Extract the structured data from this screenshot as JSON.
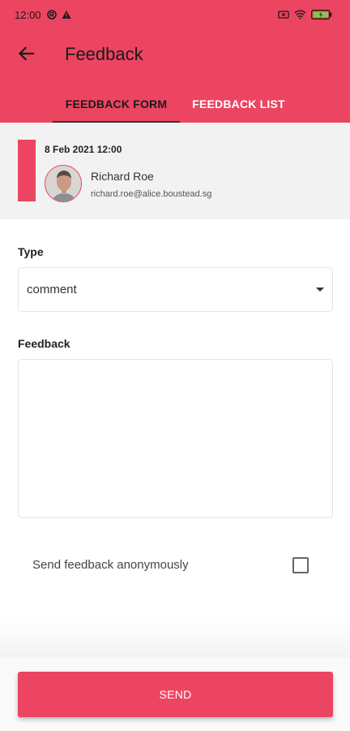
{
  "status_bar": {
    "time": "12:00",
    "left_icons": [
      "app-notification-icon",
      "alert-icon"
    ],
    "right_icons": [
      "screen-cast-icon",
      "wifi-icon",
      "battery-icon"
    ]
  },
  "header": {
    "title": "Feedback",
    "back_icon": "arrow-left-icon"
  },
  "tabs": [
    {
      "label": "FEEDBACK FORM",
      "active": true
    },
    {
      "label": "FEEDBACK LIST",
      "active": false
    }
  ],
  "info_card": {
    "date": "8 Feb 2021 12:00",
    "user_name": "Richard Roe",
    "user_email": "richard.roe@alice.boustead.sg"
  },
  "form": {
    "type_label": "Type",
    "type_value": "comment",
    "feedback_label": "Feedback",
    "feedback_value": "",
    "anonymous_label": "Send feedback anonymously",
    "anonymous_checked": false
  },
  "actions": {
    "send_label": "SEND"
  },
  "colors": {
    "accent": "#ec4561",
    "card_background": "#f2f2f2"
  }
}
